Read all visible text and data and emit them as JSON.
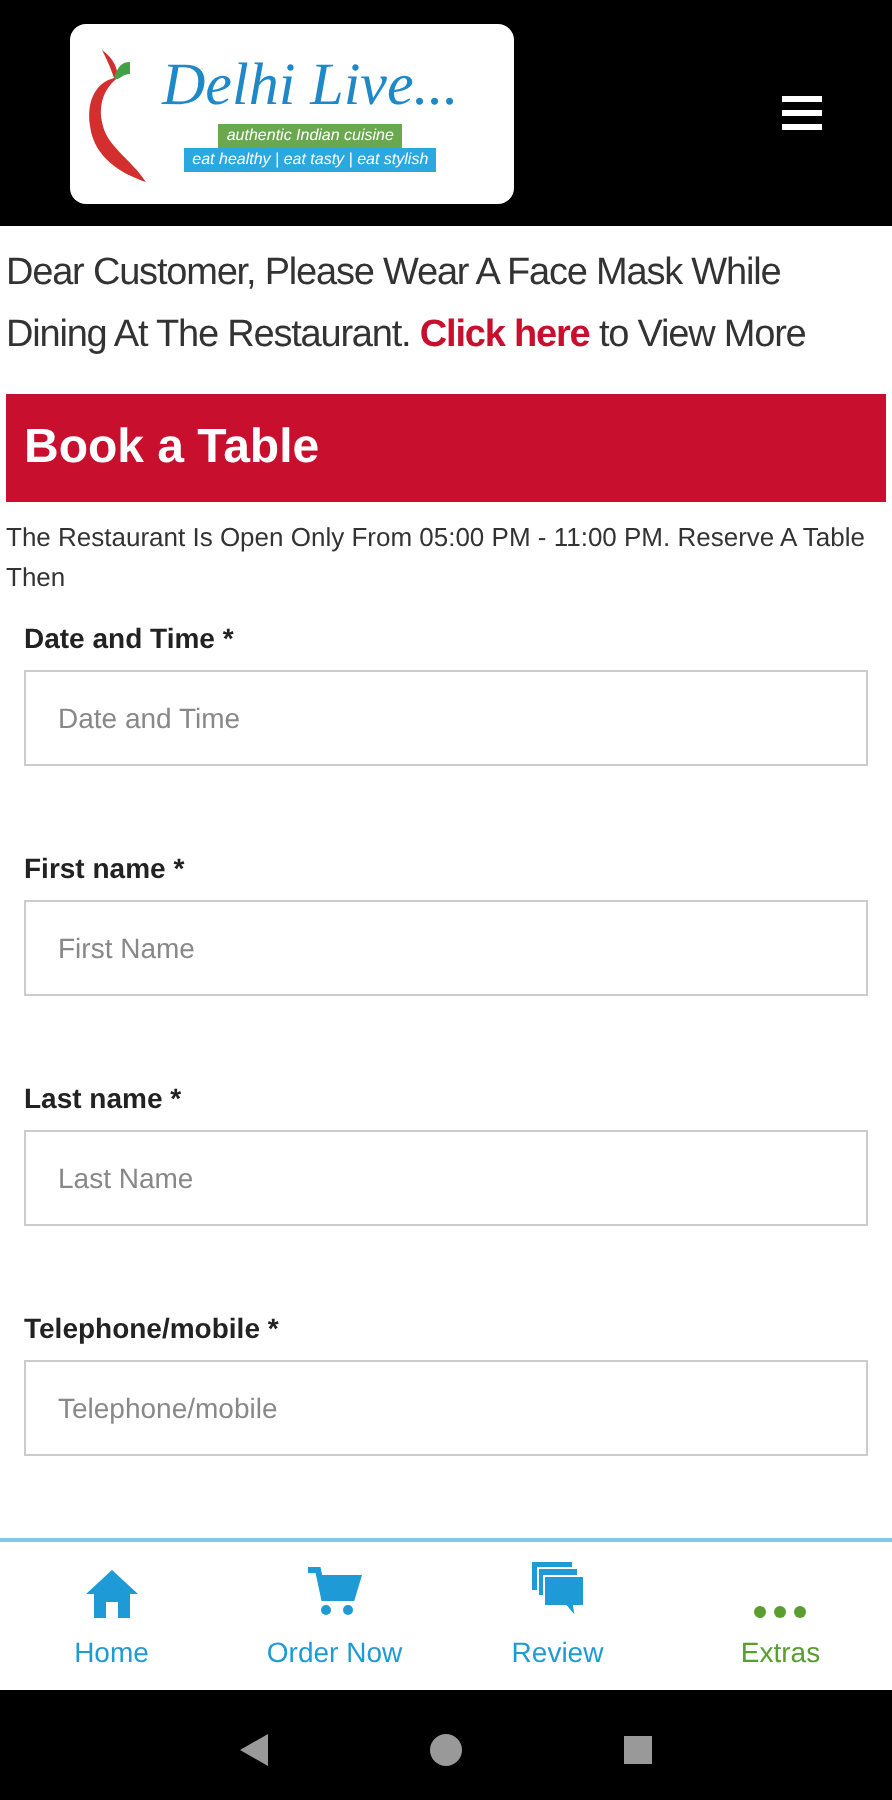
{
  "logo": {
    "title": "Delhi Live...",
    "tagline": "authentic Indian cuisine",
    "motto": "eat healthy | eat tasty | eat stylish"
  },
  "notice": {
    "text": "Dear Customer, Please Wear A Face Mask While Dining At The Restaurant.",
    "link": "Click here",
    "after": "to View More"
  },
  "banner": "Book a Table",
  "hours": "The Restaurant Is Open Only From 05:00 PM - 11:00 PM. Reserve A Table Then",
  "fields": [
    {
      "label": "Date and Time *",
      "placeholder": "Date and Time"
    },
    {
      "label": "First name *",
      "placeholder": "First Name"
    },
    {
      "label": "Last name *",
      "placeholder": "Last Name"
    },
    {
      "label": "Telephone/mobile *",
      "placeholder": "Telephone/mobile"
    }
  ],
  "nav": [
    {
      "kind": "home",
      "label": "Home",
      "selected": false
    },
    {
      "kind": "cart",
      "label": "Order Now",
      "selected": false
    },
    {
      "kind": "review",
      "label": "Review",
      "selected": false
    },
    {
      "kind": "more",
      "label": "Extras",
      "selected": true
    }
  ]
}
